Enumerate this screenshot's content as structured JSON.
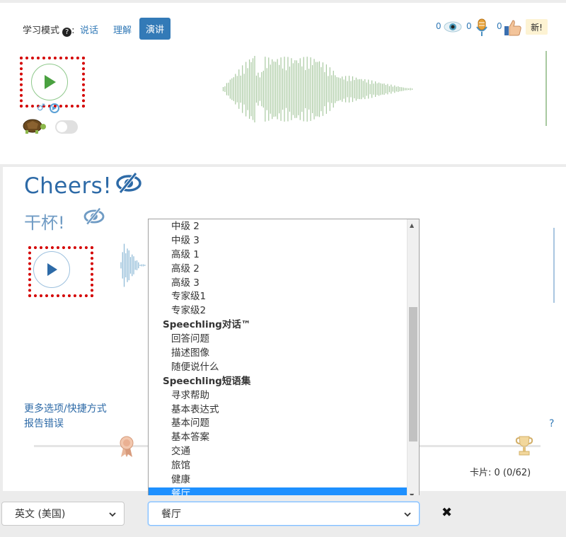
{
  "learning_mode": {
    "label": "学习模式",
    "options": [
      "说话",
      "理解"
    ],
    "active": "演讲"
  },
  "stats": {
    "views": "0",
    "recordings": "0",
    "likes": "0",
    "new_badge": "新!"
  },
  "phrase": {
    "text": "Cheers!",
    "translation": "干杯!"
  },
  "links": {
    "more_options": "更多选项/快捷方式",
    "report_error": "报告错误",
    "help": "?"
  },
  "cards": {
    "label": "卡片: 0 (0/62)"
  },
  "category_list": {
    "items": [
      {
        "label": "中级 2",
        "group": false
      },
      {
        "label": "中级 3",
        "group": false
      },
      {
        "label": "高级 1",
        "group": false
      },
      {
        "label": "高级 2",
        "group": false
      },
      {
        "label": "高级 3",
        "group": false
      },
      {
        "label": "专家级1",
        "group": false
      },
      {
        "label": "专家级2",
        "group": false
      },
      {
        "label": "Speechling对话™",
        "group": true
      },
      {
        "label": "回答问题",
        "group": false
      },
      {
        "label": "描述图像",
        "group": false
      },
      {
        "label": "随便说什么",
        "group": false
      },
      {
        "label": "Speechling短语集",
        "group": true
      },
      {
        "label": "寻求帮助",
        "group": false
      },
      {
        "label": "基本表达式",
        "group": false
      },
      {
        "label": "基本问题",
        "group": false
      },
      {
        "label": "基本答案",
        "group": false
      },
      {
        "label": "交通",
        "group": false
      },
      {
        "label": "旅馆",
        "group": false
      },
      {
        "label": "健康",
        "group": false
      },
      {
        "label": "餐厅",
        "group": false,
        "selected": true
      }
    ]
  },
  "bottom_bar": {
    "language_select": "英文 (美国)",
    "category_select": "餐厅",
    "close_label": "✖"
  },
  "colors": {
    "accent": "#337ab7",
    "selected": "#1e90ff",
    "waveform_native": "#a8c9a0",
    "waveform_user": "#8ab8d6",
    "play_green": "#4aa140",
    "play_blue": "#2d6aa7"
  }
}
